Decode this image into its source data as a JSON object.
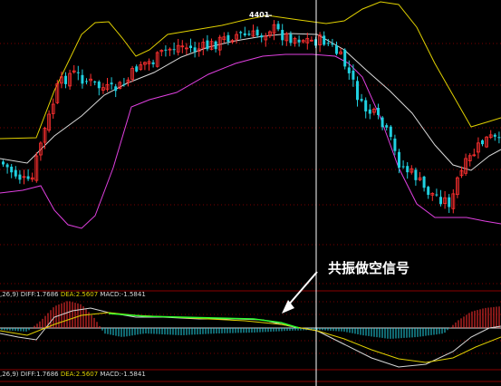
{
  "chart": {
    "high_label": "4401",
    "annotation": "共振做空信号",
    "macd_rows": [
      {
        "params": ",26,9)",
        "diff_label": "DIFF:",
        "diff": "1.7686",
        "dea_label": "DEA:",
        "dea": "2.5607",
        "macd_label": "MACD:",
        "macd": "-1.5841"
      },
      {
        "params": ",26,9)",
        "diff_label": "DIFF:",
        "diff": "1.7686",
        "dea_label": "DEA:",
        "dea": "2.5607",
        "macd_label": "MACD:",
        "macd": "-1.5841"
      }
    ],
    "colors": {
      "up": "#ff3030",
      "down": "#20d0e0",
      "mid": "#d8d8d8",
      "upper": "#e0d000",
      "lower": "#e040e0",
      "cursor": "#ffffff",
      "green": "#30ff30"
    }
  },
  "chart_data": {
    "type": "candlestick",
    "marked_high": 4401,
    "macd": {
      "diff": 1.7686,
      "dea": 2.5607,
      "macd": -1.5841
    }
  }
}
